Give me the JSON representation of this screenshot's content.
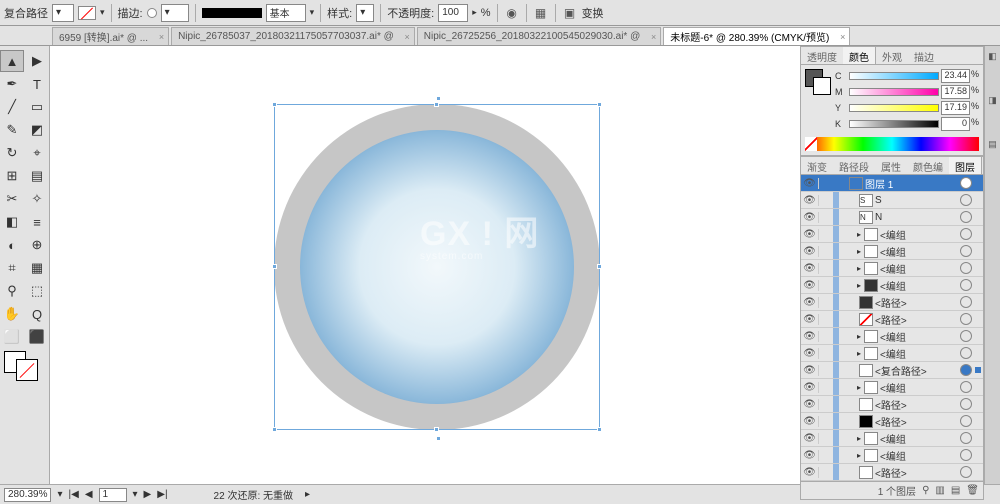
{
  "optbar": {
    "object_label": "复合路径",
    "stroke_label": "描边:",
    "stroke_preset": "基本",
    "style_label": "样式:",
    "opacity_label": "不透明度:",
    "opacity_value": "100",
    "opacity_pct": "%",
    "transform_label": "变换"
  },
  "tabs": [
    {
      "label": "6959 [转换].ai* @ ..."
    },
    {
      "label": "Nipic_26785037_20180321175057703037.ai* @"
    },
    {
      "label": "Nipic_26725256_20180322100545029030.ai* @"
    },
    {
      "label": "未标题-6* @ 280.39% (CMYK/预览)"
    }
  ],
  "active_tab": 3,
  "watermark": {
    "big": "GX ! 网",
    "small": "system.com"
  },
  "color_panel": {
    "tabs": [
      "透明度",
      "颜色",
      "外观",
      "描边"
    ],
    "active": 1,
    "channels": [
      {
        "l": "C",
        "v": "23.44"
      },
      {
        "l": "M",
        "v": "17.58"
      },
      {
        "l": "Y",
        "v": "17.19"
      },
      {
        "l": "K",
        "v": "0"
      }
    ],
    "pct": "%"
  },
  "layers_panel": {
    "tabs": [
      "渐变",
      "路径段",
      "属性",
      "颜色编",
      "图层"
    ],
    "active": 4,
    "rows": [
      {
        "d": 0,
        "name": "图层 1",
        "sel": true,
        "th": "#3979c5",
        "tgt": true
      },
      {
        "d": 1,
        "name": "S",
        "th": "#fff",
        "box": "S"
      },
      {
        "d": 1,
        "name": "N",
        "th": "#fff",
        "box": "N"
      },
      {
        "d": 1,
        "name": "<编组",
        "th": "#fff",
        "arrow": true
      },
      {
        "d": 1,
        "name": "<编组",
        "th": "#fff",
        "arrow": true
      },
      {
        "d": 1,
        "name": "<编组",
        "th": "#fff",
        "arrow": true
      },
      {
        "d": 1,
        "name": "<编组",
        "th": "#333",
        "arrow": true
      },
      {
        "d": 1,
        "name": "<路径>",
        "th": "#333"
      },
      {
        "d": 1,
        "name": "<路径>",
        "th": "#fff",
        "slash": true
      },
      {
        "d": 1,
        "name": "<编组",
        "th": "#fff",
        "arrow": true
      },
      {
        "d": 1,
        "name": "<编组",
        "th": "#fff",
        "arrow": true
      },
      {
        "d": 1,
        "name": "<复合路径>",
        "th": "#fff",
        "tgt2": true
      },
      {
        "d": 1,
        "name": "<编组",
        "th": "#fff",
        "arrow": true
      },
      {
        "d": 1,
        "name": "<路径>",
        "th": "#fff"
      },
      {
        "d": 1,
        "name": "<路径>",
        "th": "#000"
      },
      {
        "d": 1,
        "name": "<编组",
        "th": "#fff",
        "arrow": true
      },
      {
        "d": 1,
        "name": "<编组",
        "th": "#fff",
        "arrow": true
      },
      {
        "d": 1,
        "name": "<路径>",
        "th": "#fff"
      }
    ],
    "footer": "1 个图层"
  },
  "status": {
    "zoom": "280.39%",
    "page": "1",
    "undo": "22 次还原: 无重做"
  },
  "tools": [
    "▲",
    "▶",
    "✒",
    "T",
    "╱",
    "▭",
    "✎",
    "◩",
    "↻",
    "⌖",
    "⊞",
    "▤",
    "✂",
    "✧",
    "◧",
    "≡",
    "◐",
    "⊕",
    "⌗",
    "▦",
    "⚲",
    "⬚",
    "✋",
    "Q",
    "⬜",
    "⬛"
  ]
}
